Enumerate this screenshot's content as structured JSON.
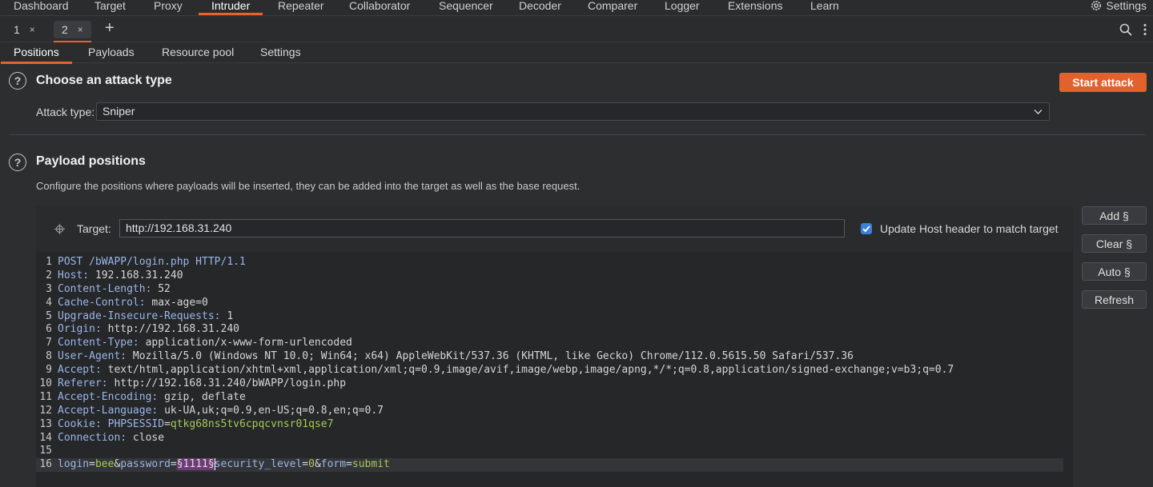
{
  "topnav": {
    "tabs": [
      "Dashboard",
      "Target",
      "Proxy",
      "Intruder",
      "Repeater",
      "Collaborator",
      "Sequencer",
      "Decoder",
      "Comparer",
      "Logger",
      "Extensions",
      "Learn"
    ],
    "active": "Intruder",
    "settings_label": "Settings"
  },
  "attack_tabs": [
    {
      "label": "1",
      "close": "×"
    },
    {
      "label": "2",
      "close": "×"
    }
  ],
  "add_tab_label": "+",
  "subtabs": [
    "Positions",
    "Payloads",
    "Resource pool",
    "Settings"
  ],
  "attack_section": {
    "title": "Choose an attack type",
    "start_label": "Start attack",
    "type_label": "Attack type:",
    "type_value": "Sniper"
  },
  "payload_section": {
    "title": "Payload positions",
    "description": "Configure the positions where payloads will be inserted, they can be added into the target as well as the base request.",
    "target_label": "Target:",
    "target_value": "http://192.168.31.240",
    "update_host_label": "Update Host header to match target",
    "update_host_checked": true
  },
  "side_buttons": [
    "Add §",
    "Clear §",
    "Auto §",
    "Refresh"
  ],
  "request_lines": [
    {
      "n": "1",
      "key": "POST /bWAPP/login.php HTTP/1.1",
      "sep": "",
      "val": ""
    },
    {
      "n": "2",
      "key": "Host:",
      "sep": " ",
      "val": "192.168.31.240"
    },
    {
      "n": "3",
      "key": "Content-Length:",
      "sep": " ",
      "val": "52"
    },
    {
      "n": "4",
      "key": "Cache-Control:",
      "sep": " ",
      "val": "max-age=0"
    },
    {
      "n": "5",
      "key": "Upgrade-Insecure-Requests:",
      "sep": " ",
      "val": "1"
    },
    {
      "n": "6",
      "key": "Origin:",
      "sep": " ",
      "val": "http://192.168.31.240"
    },
    {
      "n": "7",
      "key": "Content-Type:",
      "sep": " ",
      "val": "application/x-www-form-urlencoded"
    },
    {
      "n": "8",
      "key": "User-Agent:",
      "sep": " ",
      "val": "Mozilla/5.0 (Windows NT 10.0; Win64; x64) AppleWebKit/537.36 (KHTML, like Gecko) Chrome/112.0.5615.50 Safari/537.36"
    },
    {
      "n": "9",
      "key": "Accept:",
      "sep": " ",
      "val": "text/html,application/xhtml+xml,application/xml;q=0.9,image/avif,image/webp,image/apng,*/*;q=0.8,application/signed-exchange;v=b3;q=0.7"
    },
    {
      "n": "10",
      "key": "Referer:",
      "sep": " ",
      "val": "http://192.168.31.240/bWAPP/login.php"
    },
    {
      "n": "11",
      "key": "Accept-Encoding:",
      "sep": " ",
      "val": "gzip, deflate"
    },
    {
      "n": "12",
      "key": "Accept-Language:",
      "sep": " ",
      "val": "uk-UA,uk;q=0.9,en-US;q=0.8,en;q=0.7"
    },
    {
      "n": "13",
      "key": "Cookie:",
      "sep": " ",
      "val": ""
    },
    {
      "n": "14",
      "key": "Connection:",
      "sep": " ",
      "val": "close"
    },
    {
      "n": "15",
      "key": "",
      "sep": "",
      "val": ""
    }
  ],
  "cookie": {
    "name": "PHPSESSID",
    "eq": "=",
    "value": "qtkg68ns5tv6cpqcvnsr01qse7"
  },
  "body_line": {
    "n": "16",
    "p1_name": "login",
    "eq1": "=",
    "p1_value": "bee",
    "amp1": "&",
    "p2_name": "password",
    "eq2": "=",
    "payload": "§1111§",
    "amp2": "",
    "p3_name": "security_level",
    "eq3": "=",
    "p3_value": "0",
    "amp3": "&",
    "p4_name": "form",
    "eq4": "=",
    "p4_value": "submit"
  }
}
